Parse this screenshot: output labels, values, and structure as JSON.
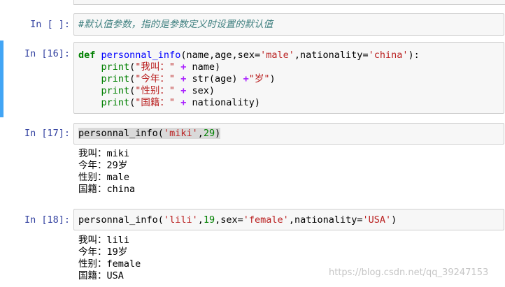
{
  "cells": [
    {
      "prompt": "In [ ]:",
      "comment": "#默认值参数，指的是参数定义时设置的默认值"
    },
    {
      "prompt": "In [16]:",
      "def_keyword": "def",
      "func_name": "personnal_info",
      "params_a": "(name,age,sex=",
      "default_sex": "'male'",
      "params_b": ",nationality=",
      "default_nationality": "'china'",
      "params_c": "):",
      "lines": [
        {
          "builtin": "print",
          "open": "(",
          "str": "\"我叫：\"",
          "op": " + ",
          "rest": "name)"
        },
        {
          "builtin": "print",
          "open": "(",
          "str": "\"今年：\"",
          "op": " + ",
          "rest": "str(age) ",
          "op2": "+",
          "str2": "\"岁\"",
          "close": ")"
        },
        {
          "builtin": "print",
          "open": "(",
          "str": "\"性别：\"",
          "op": " + ",
          "rest": "sex)"
        },
        {
          "builtin": "print",
          "open": "(",
          "str": "\"国籍：\"",
          "op": " + ",
          "rest": "nationality)"
        }
      ]
    },
    {
      "prompt": "In [17]:",
      "call_name": "personnal_info",
      "arg1": "'miki'",
      "arg2": "29",
      "output": [
        "我叫：miki",
        "今年：29岁",
        "性别：male",
        "国籍：china"
      ]
    },
    {
      "prompt": "In [18]:",
      "call_name": "personnal_info",
      "arg1": "'lili'",
      "arg2": "19",
      "kw1": "sex=",
      "arg3": "'female'",
      "kw2": "nationality=",
      "arg4": "'USA'",
      "output": [
        "我叫：lili",
        "今年：19岁",
        "性别：female",
        "国籍：USA"
      ]
    }
  ],
  "watermark": "https://blog.csdn.net/qq_39247153",
  "colors": {
    "prompt": "#303f9f",
    "selected_border": "#42a5f5",
    "cell_bg": "#f7f7f7"
  }
}
